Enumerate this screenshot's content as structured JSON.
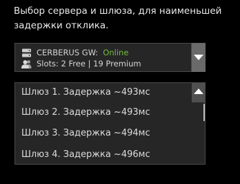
{
  "description": "Выбор сервера и шлюза, для наименьшей задержки отклика.",
  "server": {
    "name": "CERBERUS GW:",
    "status": "Online",
    "slots": "Slots: 2 Free | 19 Premium",
    "status_color": "#6fbf3e",
    "server_icon": "server-icon",
    "users_icon": "users-icon",
    "toggle_icon": "chevron-down-icon"
  },
  "gateways": [
    "Шлюз 1. Задержка ~493мс",
    "Шлюз 2. Задержка ~493мс",
    "Шлюз 3. Задержка ~494мс",
    "Шлюз 4. Задержка ~496мс"
  ],
  "gateway_list": {
    "toggle_icon": "chevron-up-icon"
  }
}
